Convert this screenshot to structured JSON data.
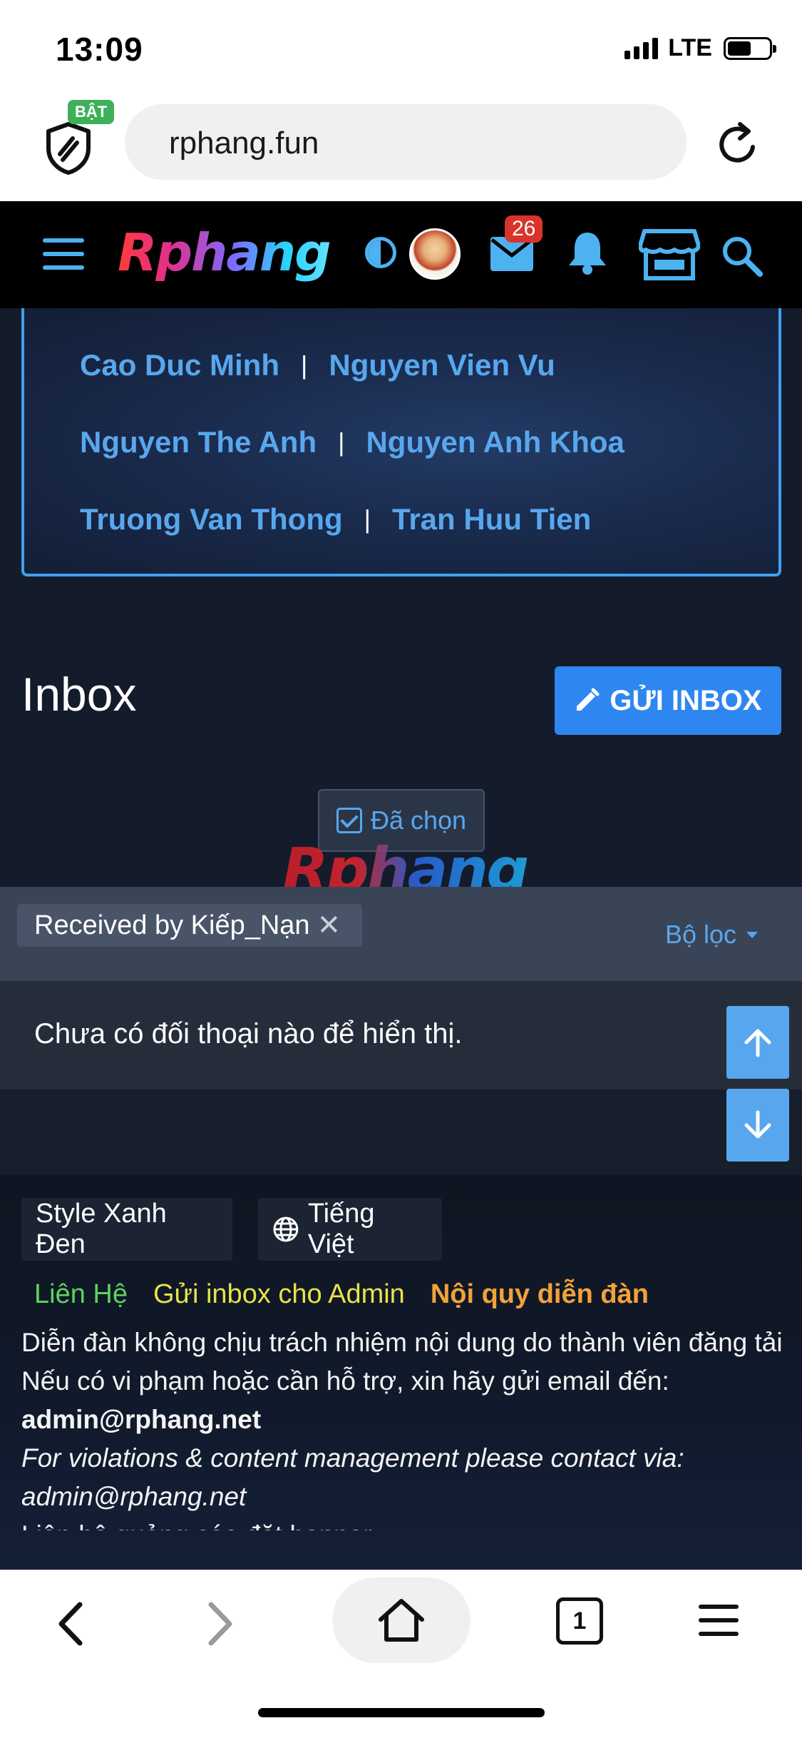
{
  "status_bar": {
    "time": "13:09",
    "network": "LTE"
  },
  "browser": {
    "url": "rphang.fun",
    "shield_badge": "BẬT",
    "tab_count": "1"
  },
  "site_header": {
    "logo": "Rphang",
    "mail_count": "26"
  },
  "names": [
    [
      "Cao Duc Minh",
      "Nguyen Vien Vu"
    ],
    [
      "Nguyen The Anh",
      "Nguyen Anh Khoa"
    ],
    [
      "Truong Van Thong",
      "Tran Huu Tien"
    ]
  ],
  "names_separator": "|",
  "inbox": {
    "title": "Inbox",
    "send_label": "GỬI INBOX",
    "selected_label": "Đã chọn",
    "watermark": "Rphang",
    "filter_chip": "Received by Kiếp_Nạn",
    "filter_close": "✕",
    "filter_label": "Bộ lọc",
    "empty_text": "Chưa có đối thoại nào để hiển thị."
  },
  "footer": {
    "style_label": "Style Xanh Đen",
    "language_label": "Tiếng Việt",
    "links": {
      "contact": "Liên Hệ",
      "admin": "Gửi inbox cho Admin",
      "rules": "Nội quy diễn đàn"
    },
    "disclaimer_1": "Diễn đàn không chịu trách nhiệm nội dung do thành viên đăng tải",
    "disclaimer_2": "Nếu có vi phạm hoặc cần hỗ trợ, xin hãy gửi email đến:",
    "email_1": "admin@rphang.net",
    "disclaimer_en": "For violations & content management please contact via:",
    "email_2": "admin@rphang.net",
    "cut_line": "Liên hệ quảng cáo đặt banner"
  },
  "colors": {
    "accent": "#2e86f0",
    "link": "#58a7ee",
    "background": "#141b2b"
  }
}
